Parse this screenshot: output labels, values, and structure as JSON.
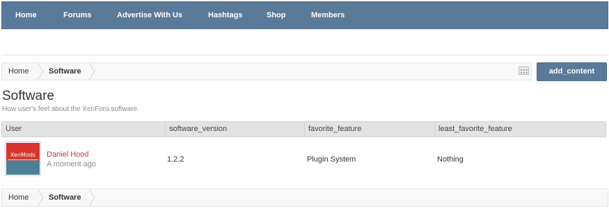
{
  "nav": {
    "items": [
      {
        "label": "Home"
      },
      {
        "label": "Forums"
      },
      {
        "label": "Advertise With Us"
      },
      {
        "label": "Hashtags"
      },
      {
        "label": "Shop"
      },
      {
        "label": "Members"
      }
    ]
  },
  "breadcrumb": {
    "items": [
      {
        "label": "Home"
      },
      {
        "label": "Software"
      }
    ]
  },
  "actions": {
    "add_content_label": "add_content"
  },
  "page": {
    "title": "Software",
    "subtitle": "How user's feel about the XenForo software."
  },
  "table": {
    "columns": [
      "User",
      "software_version",
      "favorite_feature",
      "least_favorite_feature"
    ],
    "rows": [
      {
        "avatar_text": "XenMods",
        "user": "Daniel Hood",
        "time": "A moment ago",
        "software_version": "1.2.2",
        "favorite_feature": "Plugin System",
        "least_favorite_feature": "Nothing"
      }
    ]
  },
  "colors": {
    "nav_bg": "#5a7a9a",
    "button_bg": "#5a7a9a",
    "username": "#c04040"
  }
}
